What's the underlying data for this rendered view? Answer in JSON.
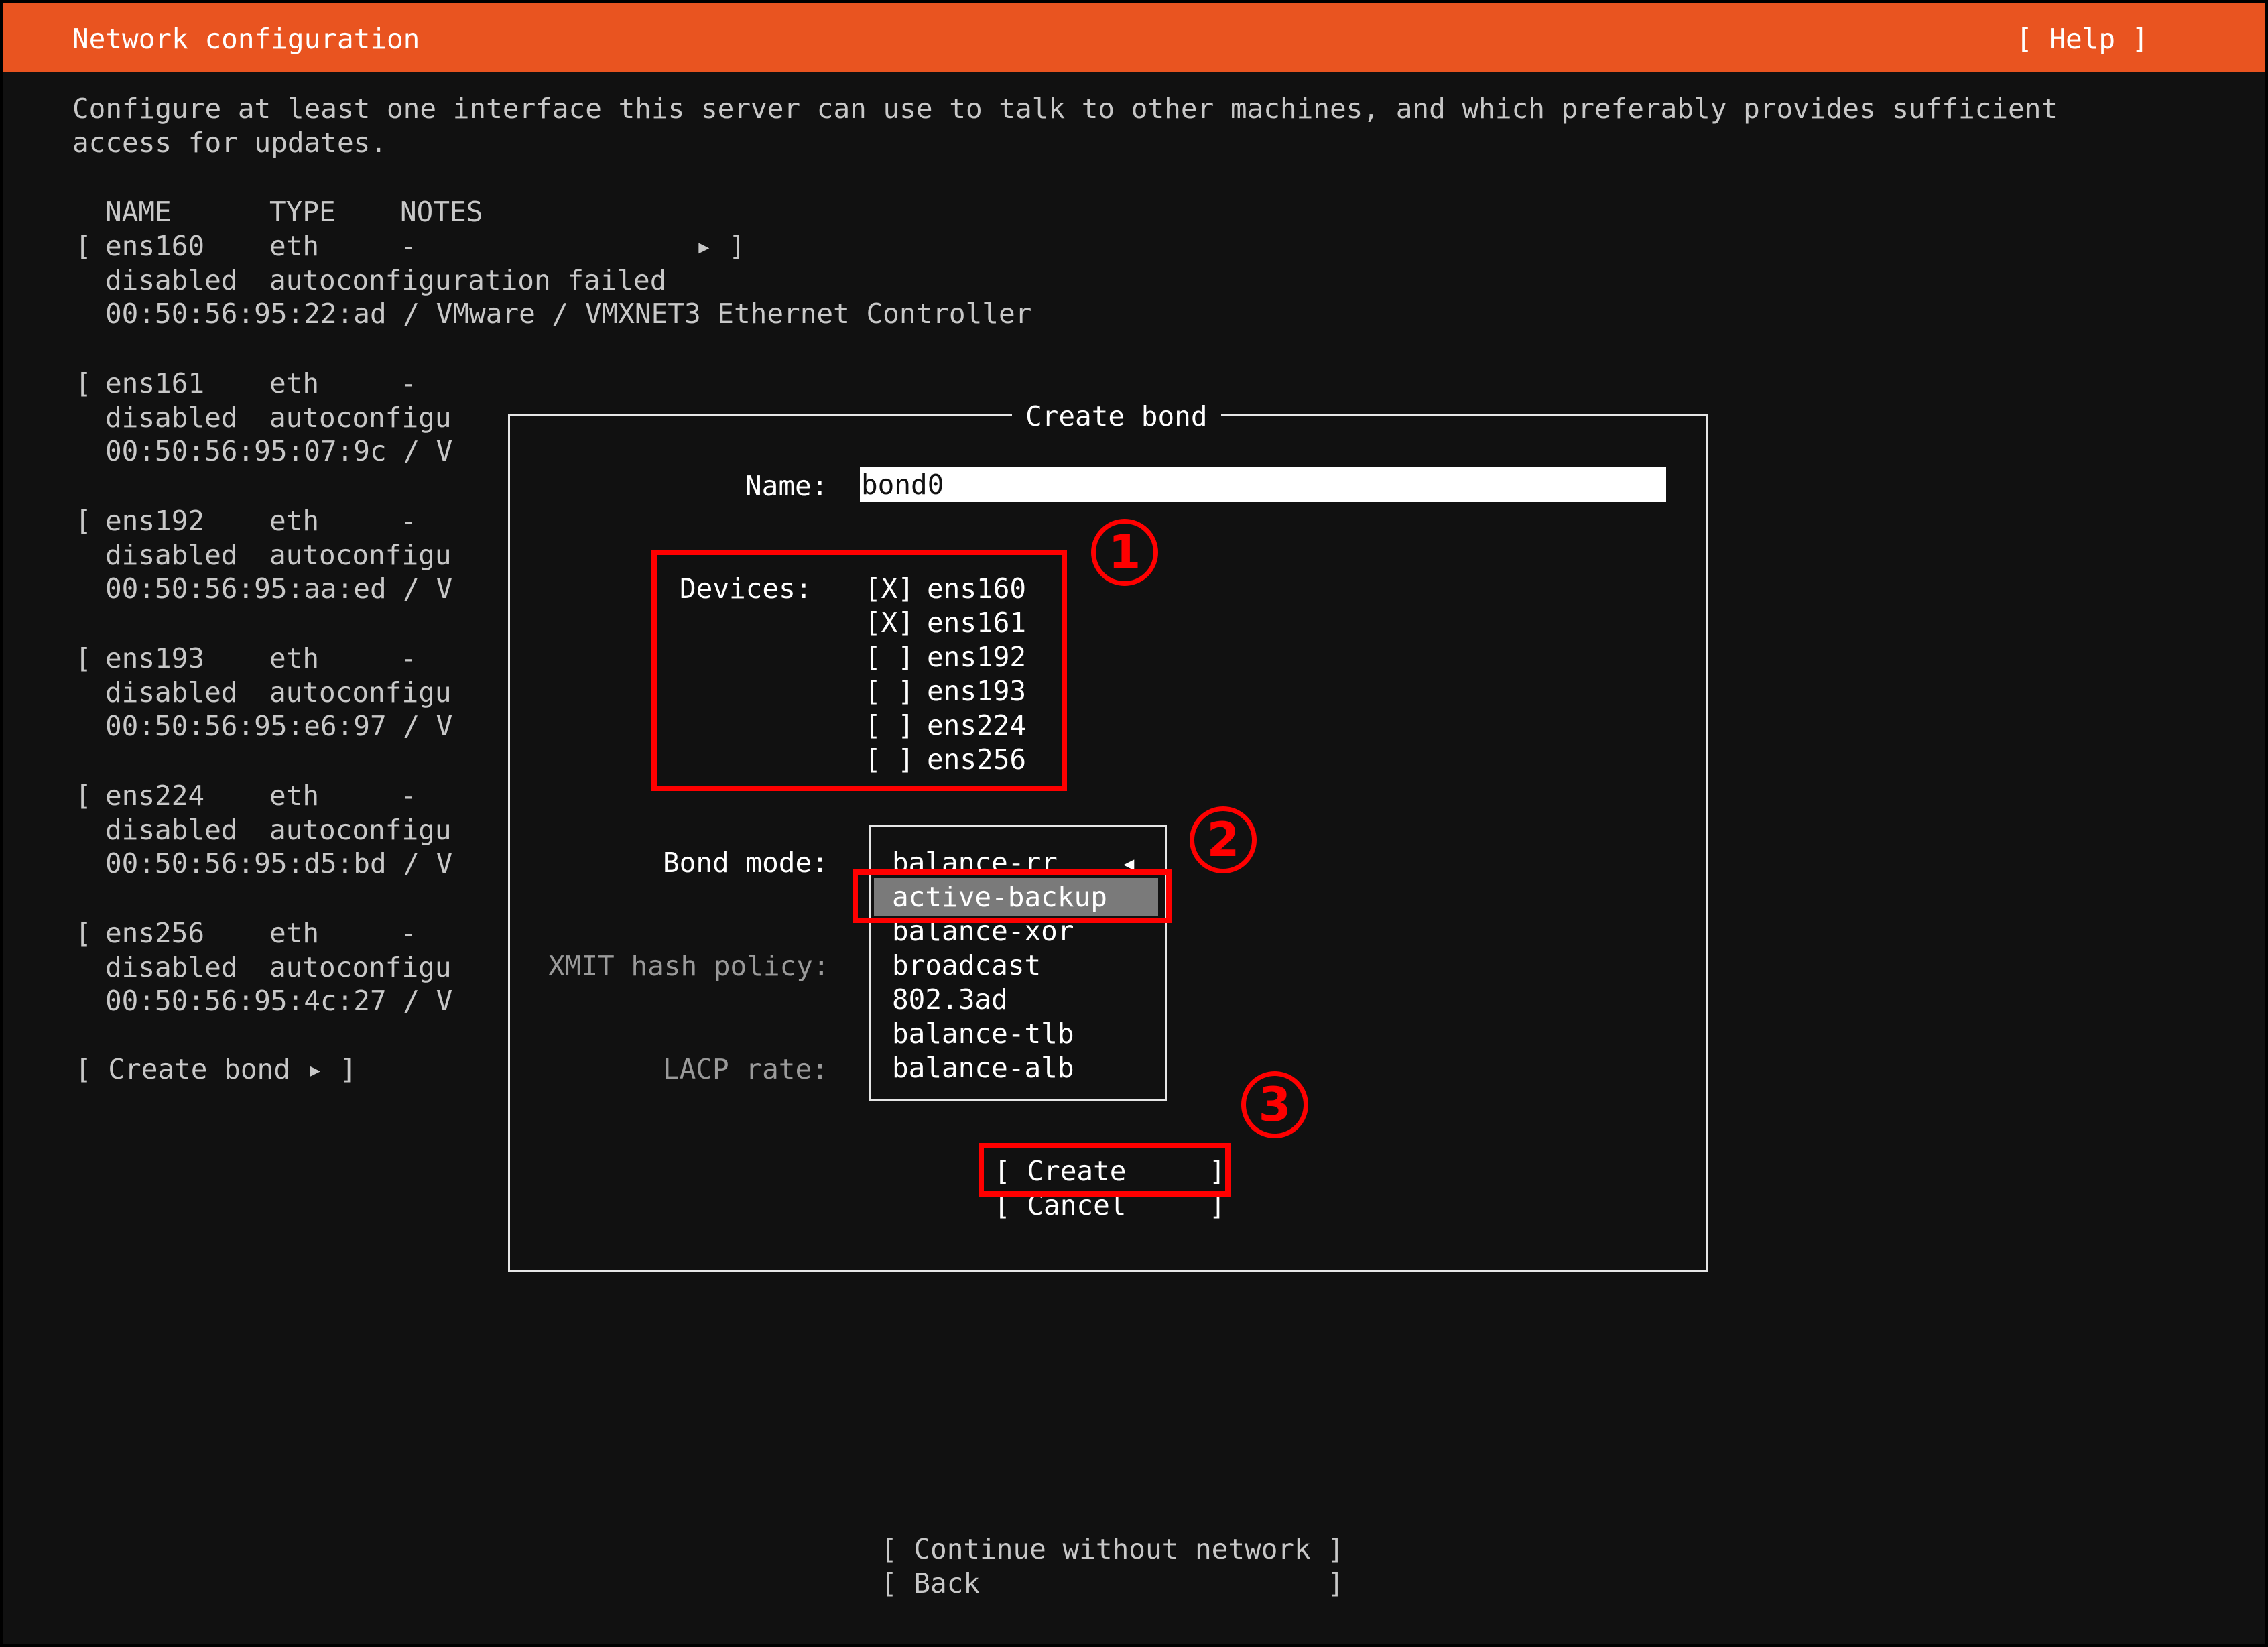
{
  "header": {
    "title": "Network configuration",
    "help": "[ Help ]"
  },
  "intro": {
    "line1": "Configure at least one interface this server can use to talk to other machines, and which preferably provides sufficient",
    "line2": "access for updates."
  },
  "table": {
    "headers": {
      "name": "NAME",
      "type": "TYPE",
      "notes": "NOTES"
    },
    "first": {
      "bracket_open": "[",
      "name": "ens160",
      "type": "eth",
      "notes": "-",
      "arrow": "▸ ]",
      "state": "disabled",
      "status": "autoconfiguration failed",
      "mac": "00:50:56:95:22:ad / VMware / VMXNET3 Ethernet Controller"
    },
    "rows": [
      {
        "name": "ens161",
        "type": "eth",
        "notes": "-",
        "state": "disabled",
        "status": "autoconfigu",
        "mac": "00:50:56:95:07:9c / V"
      },
      {
        "name": "ens192",
        "type": "eth",
        "notes": "-",
        "state": "disabled",
        "status": "autoconfigu",
        "mac": "00:50:56:95:aa:ed / V"
      },
      {
        "name": "ens193",
        "type": "eth",
        "notes": "-",
        "state": "disabled",
        "status": "autoconfigu",
        "mac": "00:50:56:95:e6:97 / V"
      },
      {
        "name": "ens224",
        "type": "eth",
        "notes": "-",
        "state": "disabled",
        "status": "autoconfigu",
        "mac": "00:50:56:95:d5:bd / V"
      },
      {
        "name": "ens256",
        "type": "eth",
        "notes": "-",
        "state": "disabled",
        "status": "autoconfigu",
        "mac": "00:50:56:95:4c:27 / V"
      }
    ],
    "create_bond": "[ Create bond ▸ ]"
  },
  "dialog": {
    "title": "Create bond",
    "name_label": "Name:",
    "name_value": "bond0",
    "devices_label": "Devices:",
    "devices": [
      {
        "check": "[X]",
        "name": "ens160"
      },
      {
        "check": "[X]",
        "name": "ens161"
      },
      {
        "check": "[ ]",
        "name": "ens192"
      },
      {
        "check": "[ ]",
        "name": "ens193"
      },
      {
        "check": "[ ]",
        "name": "ens224"
      },
      {
        "check": "[ ]",
        "name": "ens256"
      }
    ],
    "bond_mode_label": "Bond mode:",
    "bond_mode_value": "balance-rr",
    "bond_mode_arrow": "◂",
    "bond_mode_options": [
      "active-backup",
      "balance-xor",
      "broadcast",
      "802.3ad",
      "balance-tlb",
      "balance-alb"
    ],
    "xmit_label": "XMIT hash policy:",
    "lacp_label": "LACP rate:",
    "create_button": "[ Create     ]",
    "cancel_button": "[ Cancel     ]"
  },
  "callouts": [
    "1",
    "2",
    "3"
  ],
  "bottom": {
    "continue_button": "[ Continue without network ]",
    "back_button": "[ Back                     ]"
  },
  "colors": {
    "accent": "#e95420",
    "background": "#111111",
    "annotation": "#ff0000",
    "selection": "#7a7a7a"
  }
}
